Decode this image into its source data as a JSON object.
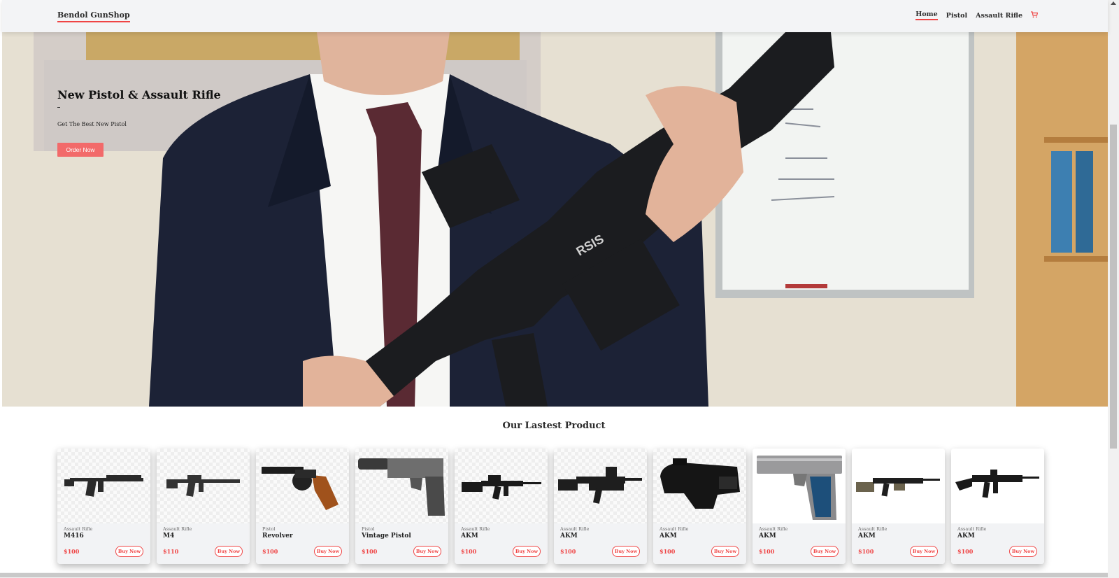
{
  "nav": {
    "brand": "Bendol GunShop",
    "links": [
      "Home",
      "Pistol",
      "Assault Rifle"
    ],
    "cart_icon": "shopping-cart-icon",
    "accent": "#ef4444"
  },
  "hero": {
    "title": "New Pistol & Assault Rifle",
    "subtitle": "Get The Best New Pistol",
    "cta": "Order Now"
  },
  "products": {
    "title": "Our Lastest Product",
    "buy_label": "Buy Now",
    "items": [
      {
        "category": "Assault Rifle",
        "name": "M416",
        "price": "$100"
      },
      {
        "category": "Assault Rifle",
        "name": "M4",
        "price": "$110"
      },
      {
        "category": "Pistol",
        "name": "Revolver",
        "price": "$100"
      },
      {
        "category": "Pistol",
        "name": "Vintage Pistol",
        "price": "$100"
      },
      {
        "category": "Assault Rifle",
        "name": "AKM",
        "price": "$100"
      },
      {
        "category": "Assault Rifle",
        "name": "AKM",
        "price": "$100"
      },
      {
        "category": "Assault Rifle",
        "name": "AKM",
        "price": "$100"
      },
      {
        "category": "Assault Rifle",
        "name": "AKM",
        "price": "$100"
      },
      {
        "category": "Assault Rifle",
        "name": "AKM",
        "price": "$100"
      },
      {
        "category": "Assault Rifle",
        "name": "AKM",
        "price": "$100"
      }
    ]
  }
}
